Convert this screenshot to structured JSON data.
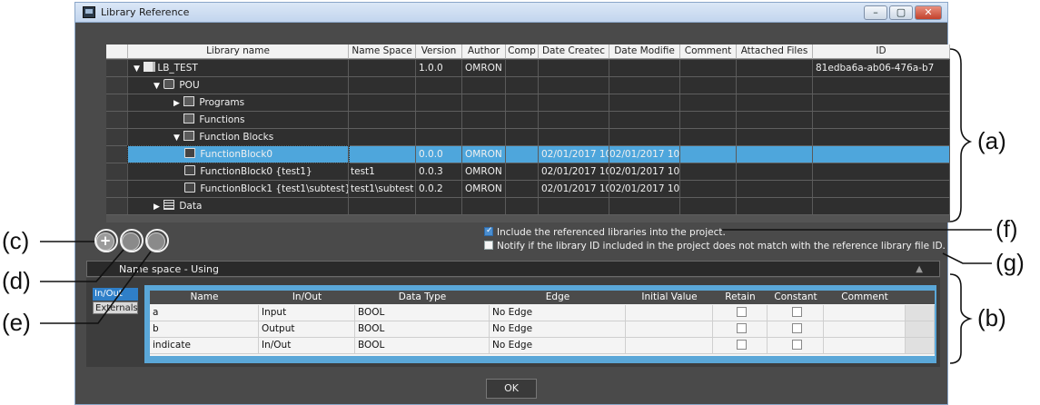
{
  "window": {
    "title": "Library Reference",
    "controls": {
      "minimize": "–",
      "maximize": "▢",
      "close": "✕"
    }
  },
  "tree": {
    "columns": [
      "Library name",
      "Name Space",
      "Version",
      "Author",
      "Comp",
      "Date Createc",
      "Date Modifie",
      "Comment",
      "Attached Files",
      "ID"
    ],
    "rows": [
      {
        "name": "LB_TEST",
        "expander": "▼",
        "namespace": "",
        "version": "1.0.0",
        "author": "OMRON",
        "created": "",
        "modified": "",
        "id": "81edba6a-ab06-476a-b7"
      },
      {
        "name": "POU",
        "expander": "▼",
        "namespace": "",
        "version": "",
        "author": "",
        "created": "",
        "modified": "",
        "id": ""
      },
      {
        "name": "Programs",
        "expander": "▶",
        "namespace": "",
        "version": "",
        "author": "",
        "created": "",
        "modified": "",
        "id": ""
      },
      {
        "name": "Functions",
        "expander": "",
        "namespace": "",
        "version": "",
        "author": "",
        "created": "",
        "modified": "",
        "id": ""
      },
      {
        "name": "Function Blocks",
        "expander": "▼",
        "namespace": "",
        "version": "",
        "author": "",
        "created": "",
        "modified": "",
        "id": ""
      },
      {
        "name": "FunctionBlock0",
        "expander": "",
        "namespace": "",
        "version": "0.0.0",
        "author": "OMRON",
        "created": "02/01/2017 10",
        "modified": "02/01/2017 10",
        "id": ""
      },
      {
        "name": "FunctionBlock0 {test1}",
        "expander": "",
        "namespace": "test1",
        "version": "0.0.3",
        "author": "OMRON",
        "created": "02/01/2017 10",
        "modified": "02/01/2017 10",
        "id": ""
      },
      {
        "name": "FunctionBlock1 {test1\\subtest}",
        "expander": "",
        "namespace": "test1\\subtest",
        "version": "0.0.2",
        "author": "OMRON",
        "created": "02/01/2017 10",
        "modified": "02/01/2017 10",
        "id": ""
      },
      {
        "name": "Data",
        "expander": "▶",
        "namespace": "",
        "version": "",
        "author": "",
        "created": "",
        "modified": "",
        "id": ""
      }
    ]
  },
  "buttons": {
    "add": "+"
  },
  "options": {
    "include_referenced": {
      "label": "Include the referenced libraries into the project.",
      "checked": true
    },
    "notify_mismatch": {
      "label": "Notify if the library ID included in the project does not match with the reference library file ID.",
      "checked": false
    }
  },
  "namespace_panel": {
    "title": "Name space - Using",
    "tabs": [
      "In/Out",
      "Externals"
    ],
    "columns": [
      "Name",
      "In/Out",
      "Data Type",
      "Edge",
      "Initial Value",
      "Retain",
      "Constant",
      "Comment"
    ],
    "rows": [
      {
        "name": "a",
        "inout": "Input",
        "type": "BOOL",
        "edge": "No Edge"
      },
      {
        "name": "b",
        "inout": "Output",
        "type": "BOOL",
        "edge": "No Edge"
      },
      {
        "name": "indicate",
        "inout": "In/Out",
        "type": "BOOL",
        "edge": "No Edge"
      }
    ]
  },
  "ok_label": "OK",
  "annotations": {
    "a": "(a)",
    "b": "(b)",
    "c": "(c)",
    "d": "(d)",
    "e": "(e)",
    "f": "(f)",
    "g": "(g)"
  },
  "colors": {
    "selected_row": "#4ea6dc",
    "panel_dark": "#4a4a4a",
    "accent_blue": "#5aa7d8"
  }
}
